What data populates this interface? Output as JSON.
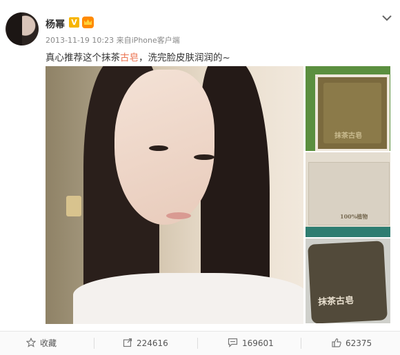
{
  "post": {
    "author": "杨幂",
    "timestamp": "2013-11-19 10:23",
    "source_prefix": "来自",
    "source": "iPhone客户端",
    "text_before": "真心推荐这个抹茶",
    "text_highlight": "古皂",
    "text_after": "，洗完脸皮肤润润的~",
    "highlight_color": "#eb7350"
  },
  "images": {
    "thumb1_label": "抹茶古皂",
    "thumb2_label": "100%植物",
    "thumb3_label": "抹茶古皂"
  },
  "actions": {
    "favorite_label": "收藏",
    "repost_count": "224616",
    "comment_count": "169601",
    "like_count": "62375"
  },
  "icons": {
    "favorite": "star-icon",
    "repost": "share-icon",
    "comment": "comment-icon",
    "like": "thumbs-up-icon",
    "menu": "chevron-down-icon",
    "verified": "verified-v-icon",
    "member": "crown-icon"
  }
}
